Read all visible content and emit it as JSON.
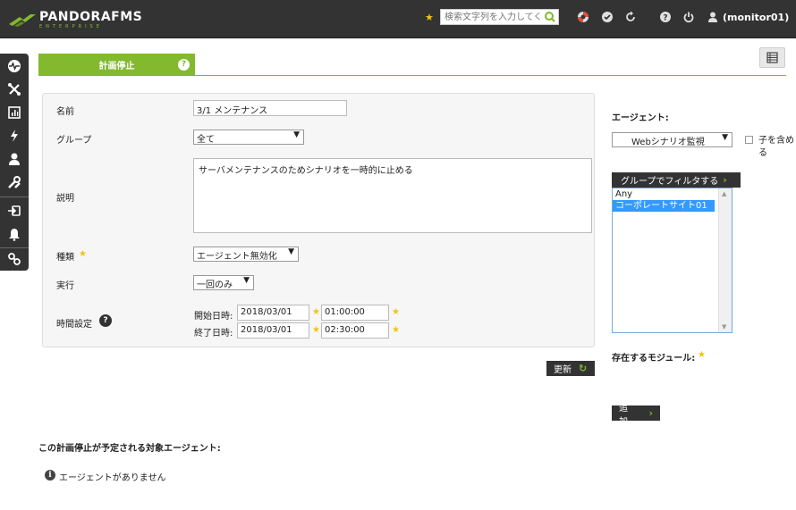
{
  "header": {
    "logo_name": "PANDORAFMS",
    "logo_sub": "ENTERPRISE",
    "search_placeholder": "検索文字列を入力してください",
    "user": "(monitor01)",
    "icons": [
      "star-icon",
      "search-icon",
      "lifebuoy-icon",
      "check-icon",
      "refresh-icon",
      "help-icon",
      "power-icon",
      "user-icon"
    ]
  },
  "sidebar": {
    "items": [
      "monitoring-icon",
      "topology-icon",
      "reports-icon",
      "events-icon",
      "users-icon",
      "tools-icon",
      "login-icon",
      "alerts-icon",
      "links-icon"
    ]
  },
  "tab": {
    "label": "計画停止",
    "help": "?"
  },
  "form": {
    "name_label": "名前",
    "name_value": "3/1 メンテナンス",
    "group_label": "グループ",
    "group_value": "全て",
    "description_label": "説明",
    "description_value": "サーバメンテナンスのためシナリオを一時的に止める",
    "type_label": "種類",
    "type_value": "エージェント無効化",
    "execution_label": "実行",
    "execution_value": "一回のみ",
    "time_label": "時間設定",
    "start_label": "開始日時:",
    "start_date": "2018/03/01",
    "start_time": "01:00:00",
    "end_label": "終了日時:",
    "end_date": "2018/03/01",
    "end_time": "02:30:00",
    "update_button": "更新"
  },
  "right": {
    "agents_label": "エージェント:",
    "agent_select": "Webシナリオ監視",
    "include_children": "子を含める",
    "filter_button": "グループでフィルタする",
    "group_options": [
      "Any",
      "コーポレートサイト01"
    ],
    "modules_label": "存在するモジュール:",
    "add_button": "追加"
  },
  "bottom": {
    "title": "この計画停止が予定される対象エージェント:",
    "message": "エージェントがありません"
  }
}
